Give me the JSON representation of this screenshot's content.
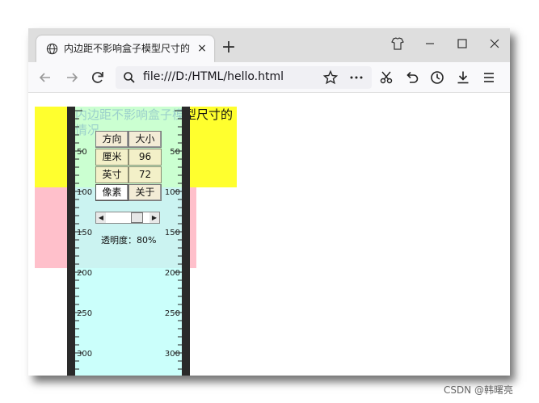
{
  "browser": {
    "tab": {
      "title": "内边距不影响盒子模型尺寸的",
      "close_glyph": "×",
      "icon": "globe-icon"
    },
    "new_tab_glyph": "+",
    "window_controls": [
      "customize-icon",
      "minimize-icon",
      "maximize-icon",
      "close-icon"
    ],
    "nav_buttons": [
      "back-icon",
      "forward-icon",
      "reload-icon"
    ],
    "url": "file:///D:/HTML/hello.html",
    "toolbar_icons": [
      "bookmark-star-icon",
      "more-icon",
      "screenshot-icon",
      "undo-icon",
      "history-icon",
      "download-icon",
      "menu-icon"
    ]
  },
  "page": {
    "demo_text": "内边距不影响盒子模型尺寸的情况",
    "colors": {
      "yellow_box": "#ffff2e",
      "pink_box": "#ffc0cb"
    }
  },
  "ruler": {
    "tick_labels": [
      "50",
      "100",
      "150",
      "200",
      "250",
      "300"
    ],
    "unit_grid": {
      "row1": [
        "方向",
        "大小"
      ],
      "row2": [
        "厘米",
        "96"
      ],
      "row3": [
        "英寸",
        "72"
      ],
      "row4": [
        "像素",
        "关于"
      ]
    },
    "opacity_label": "透明度：80%",
    "opacity_value": 0.8,
    "colors": {
      "ruler_fill": "#bffffa",
      "ruler_edge": "#2a2a2a"
    }
  },
  "watermark": "CSDN @韩曙亮"
}
